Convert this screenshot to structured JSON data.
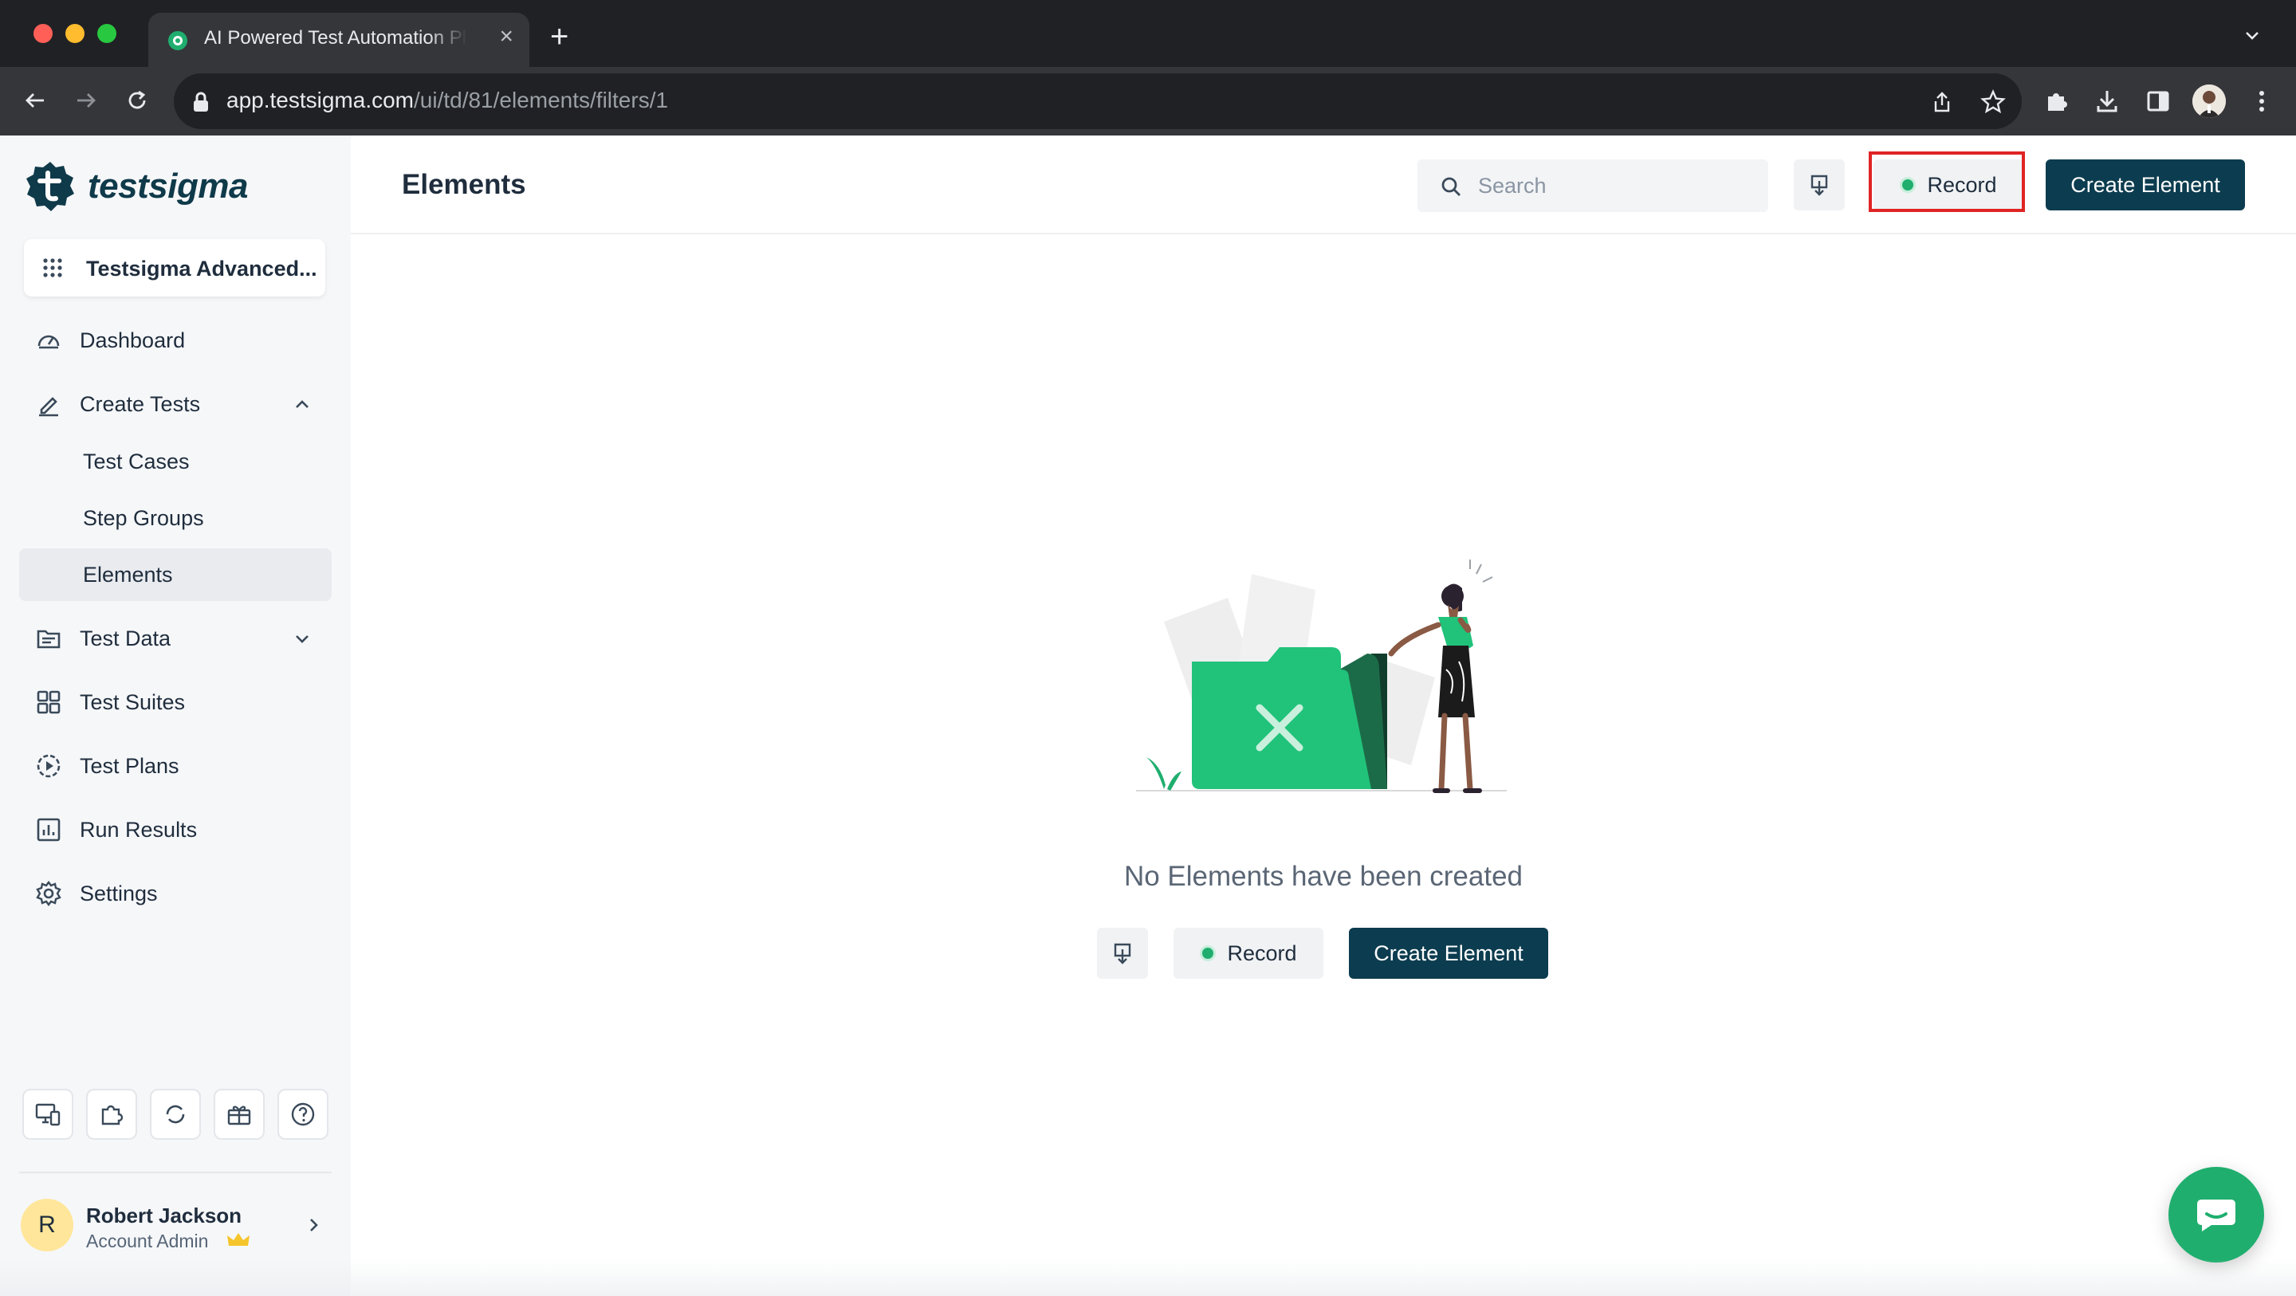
{
  "browser": {
    "tab_title": "AI Powered Test Automation Platform | Testsigma",
    "tab_close": "×",
    "new_tab": "+",
    "url_host": "app.testsigma.com",
    "url_path": "/ui/td/81/elements/filters/1"
  },
  "brand": {
    "logo_text": "testsigma",
    "color": "#0c3c4f",
    "accent": "#1fae6e"
  },
  "sidebar": {
    "workspace": "Testsigma Advanced...",
    "items": [
      {
        "label": "Dashboard",
        "icon": "dashboard-gauge-icon"
      },
      {
        "label": "Create Tests",
        "icon": "pencil-icon",
        "expanded": true
      },
      {
        "label": "Test Cases",
        "sub": true
      },
      {
        "label": "Step Groups",
        "sub": true
      },
      {
        "label": "Elements",
        "sub": true,
        "active": true
      },
      {
        "label": "Test Data",
        "icon": "test-data-icon",
        "expanded": false
      },
      {
        "label": "Test Suites",
        "icon": "grid-icon"
      },
      {
        "label": "Test Plans",
        "icon": "play-circle-icon"
      },
      {
        "label": "Run Results",
        "icon": "bar-chart-icon"
      },
      {
        "label": "Settings",
        "icon": "gear-icon"
      }
    ],
    "utility_icons": [
      "desktop-devices-icon",
      "puzzle-icon",
      "refresh-icon",
      "gift-icon",
      "help-icon"
    ],
    "user": {
      "initial": "R",
      "name": "Robert Jackson",
      "role": "Account Admin"
    }
  },
  "header": {
    "title": "Elements",
    "search_placeholder": "Search",
    "record_label": "Record",
    "create_label": "Create Element"
  },
  "empty_state": {
    "message": "No Elements have been created",
    "record_label": "Record",
    "create_label": "Create Element"
  }
}
